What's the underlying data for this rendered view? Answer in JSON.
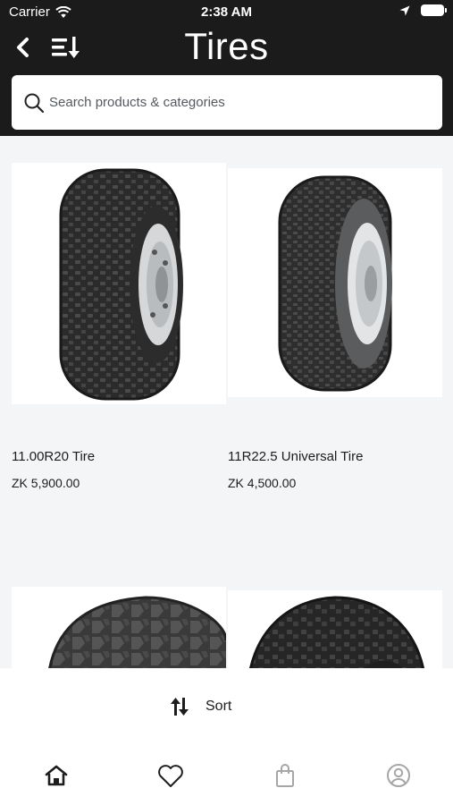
{
  "status_bar": {
    "carrier": "Carrier",
    "time": "2:38 AM"
  },
  "header": {
    "title": "Tires",
    "back_icon": "chevron-left-icon",
    "sort_icon": "sort-lines-arrow-icon"
  },
  "search": {
    "placeholder": "Search products & categories",
    "value": ""
  },
  "products": [
    {
      "name": "11.00R20 Tire",
      "price": "ZK 5,900.00"
    },
    {
      "name": "11R22.5 Universal Tire",
      "price": "ZK 4,500.00"
    },
    {
      "name": "",
      "price": ""
    },
    {
      "name": "",
      "price": ""
    }
  ],
  "sort_bar": {
    "label": "Sort",
    "icon": "sort-arrows-icon"
  },
  "tabbar": {
    "items": [
      {
        "icon": "home-icon",
        "active": true
      },
      {
        "icon": "heart-icon",
        "active": false
      },
      {
        "icon": "shopping-bag-icon",
        "active": false
      },
      {
        "icon": "user-icon",
        "active": false
      }
    ]
  },
  "colors": {
    "header_bg": "#1b1b1c",
    "page_bg": "#f3f5f7",
    "text": "#1d1d1d",
    "inactive_icon": "#a6a6a6"
  }
}
